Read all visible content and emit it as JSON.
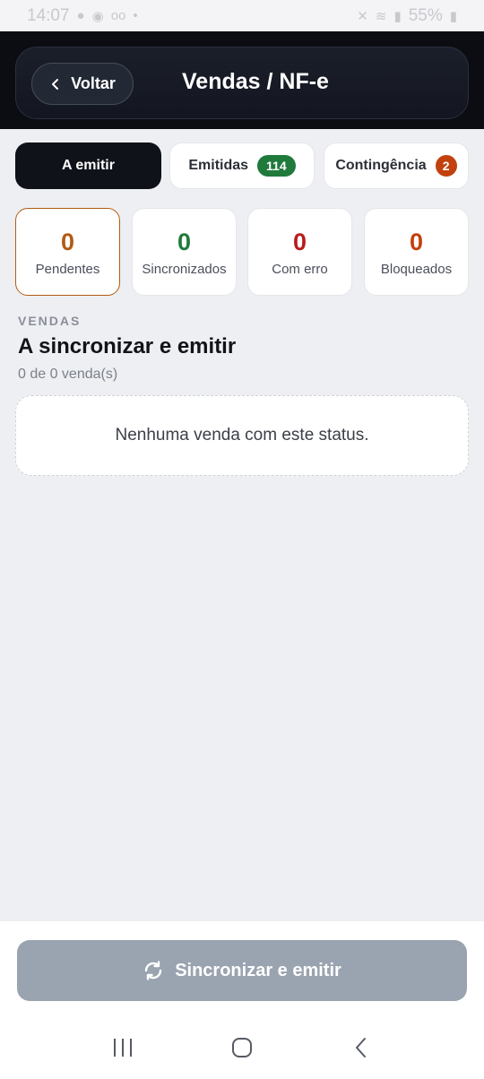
{
  "status_bar": {
    "time": "14:07",
    "battery": "55%"
  },
  "header": {
    "back_label": "Voltar",
    "title": "Vendas / NF-e"
  },
  "tabs": [
    {
      "label": "A emitir",
      "badge": null,
      "active": true
    },
    {
      "label": "Emitidas",
      "badge": "114",
      "badge_color": "#1f7a3c"
    },
    {
      "label": "Contingência",
      "badge": "2",
      "badge_color": "#c2410c"
    }
  ],
  "stats": [
    {
      "value": "0",
      "label": "Pendentes",
      "color": "#b25b12",
      "selected": true
    },
    {
      "value": "0",
      "label": "Sincronizados",
      "color": "#1f7a3c"
    },
    {
      "value": "0",
      "label": "Com erro",
      "color": "#b91c1c"
    },
    {
      "value": "0",
      "label": "Bloqueados",
      "color": "#c2410c"
    }
  ],
  "section": {
    "kicker": "VENDAS",
    "title": "A sincronizar e emitir",
    "subtitle": "0 de 0 venda(s)",
    "empty_message": "Nenhuma venda com este status."
  },
  "action": {
    "label": "Sincronizar e emitir",
    "icon": "sync-icon"
  }
}
